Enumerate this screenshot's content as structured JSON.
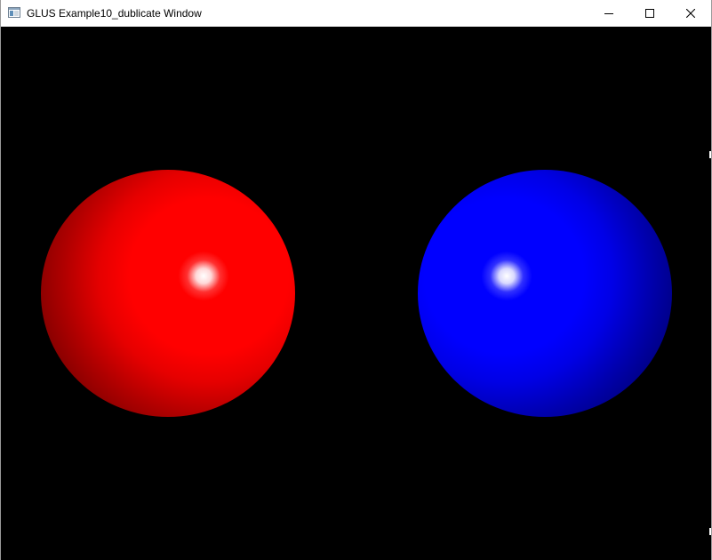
{
  "window": {
    "title": "GLUS Example10_dublicate Window",
    "icon": "app-window-icon",
    "controls": {
      "minimize_icon": "minimize-icon",
      "maximize_icon": "maximize-icon",
      "close_icon": "close-icon"
    }
  },
  "scene": {
    "background": "#000000",
    "spheres": [
      {
        "name": "red-sphere",
        "color": "#ff0000"
      },
      {
        "name": "blue-sphere",
        "color": "#0000ff"
      }
    ]
  }
}
